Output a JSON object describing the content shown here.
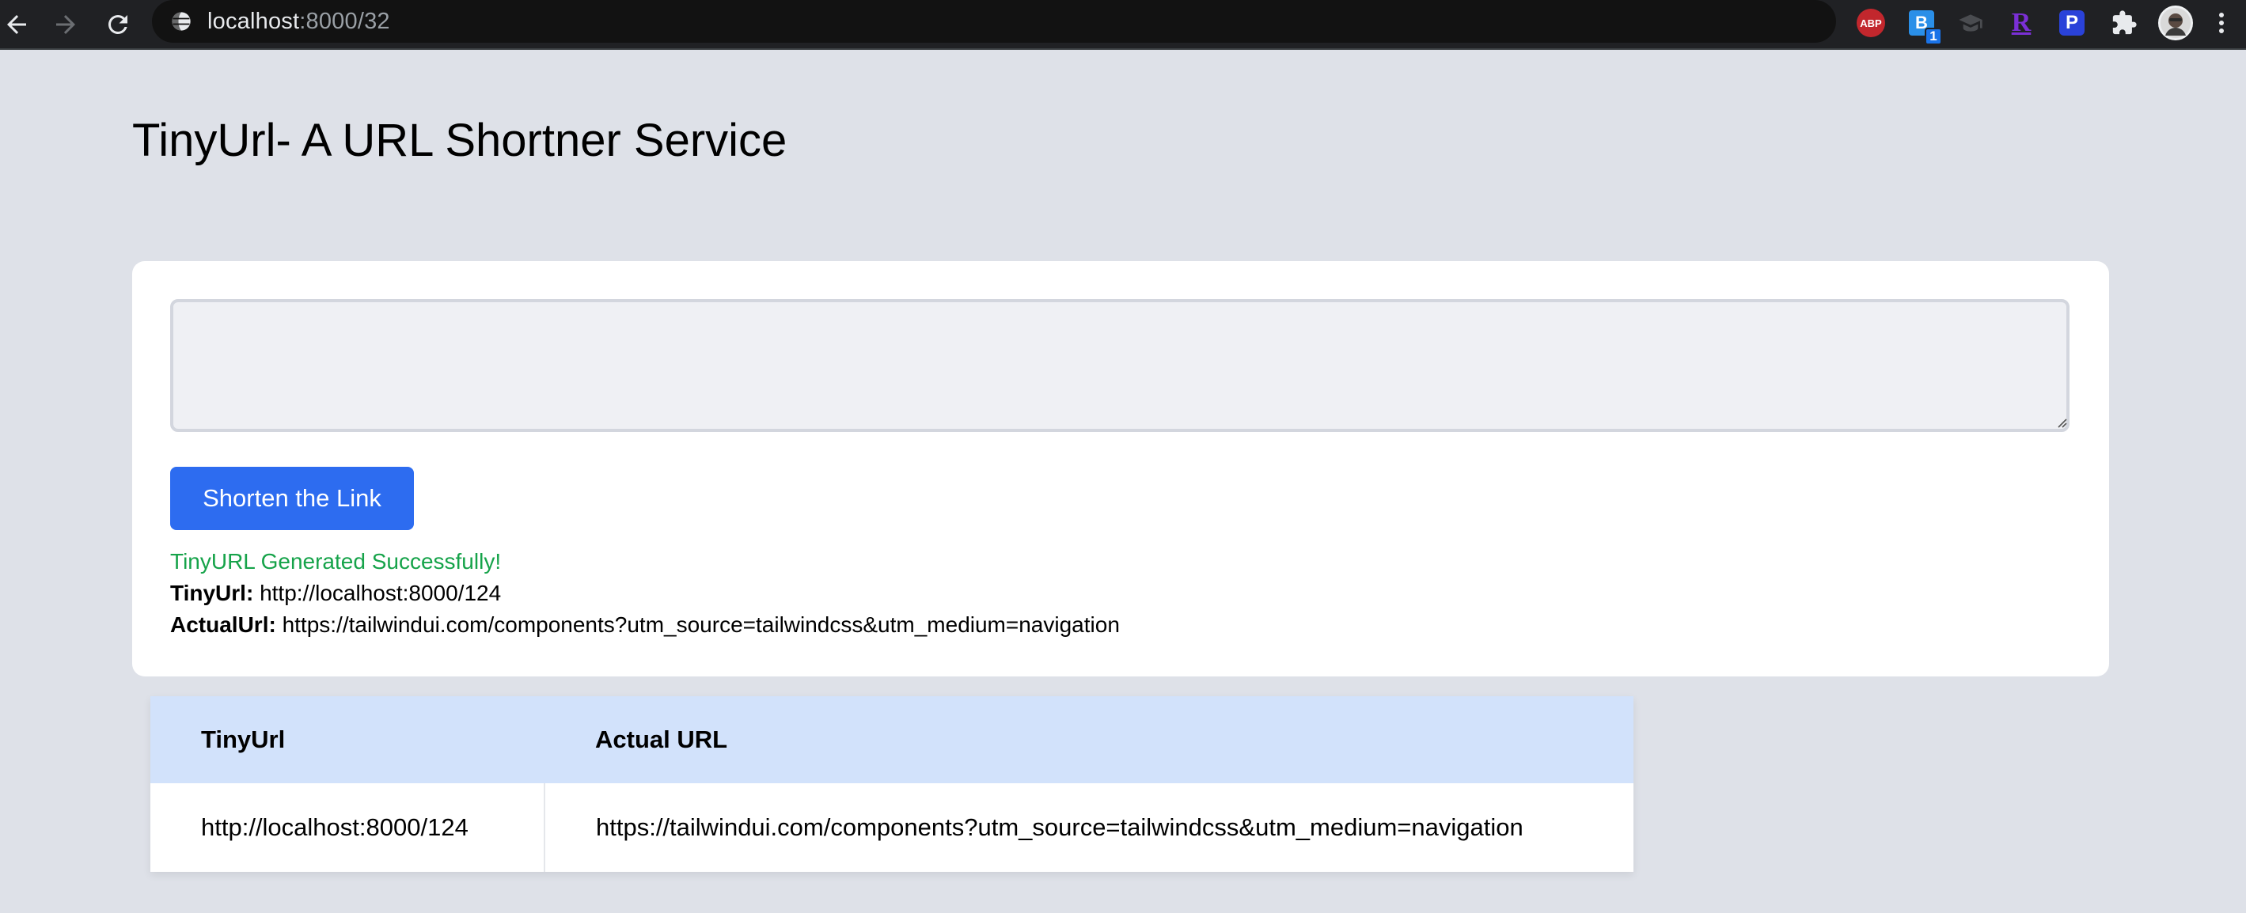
{
  "browser": {
    "url_host": "localhost",
    "url_path": ":8000/32",
    "extensions": [
      "abp-icon",
      "b-extension-icon",
      "scholar-cap-icon",
      "r-extension-icon",
      "p-extension-icon",
      "puzzle-icon"
    ],
    "abp_label": "ABP",
    "b_label": "B",
    "b_badge": "1",
    "r_label": "R",
    "p_label": "P"
  },
  "page": {
    "title": "TinyUrl- A URL Shortner Service"
  },
  "form": {
    "input_value": "",
    "button_label": "Shorten the Link",
    "success_message": "TinyURL Generated Successfully!",
    "tinyurl_label": "TinyUrl:",
    "tinyurl_value": "http://localhost:8000/124",
    "actualurl_label": "ActualUrl:",
    "actualurl_value": "https://tailwindui.com/components?utm_source=tailwindcss&utm_medium=navigation"
  },
  "table": {
    "headers": [
      "TinyUrl",
      "Actual URL"
    ],
    "rows": [
      [
        "http://localhost:8000/124",
        "https://tailwindui.com/components?utm_source=tailwindcss&utm_medium=navigation"
      ]
    ]
  },
  "colors": {
    "page_bg": "#dee1e8",
    "button": "#2d6cf0",
    "success": "#16a34a",
    "table_header": "#d2e2fb"
  }
}
